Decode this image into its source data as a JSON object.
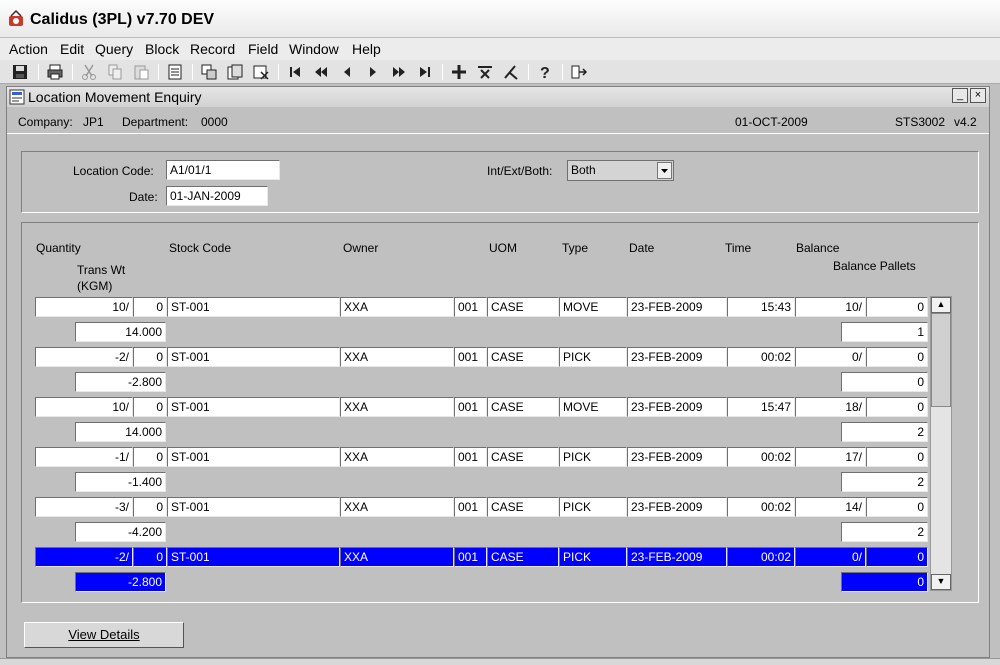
{
  "app": {
    "title": "Calidus (3PL) v7.70 DEV"
  },
  "menu": [
    "Action",
    "Edit",
    "Query",
    "Block",
    "Record",
    "Field",
    "Window",
    "Help"
  ],
  "toolbar": {
    "icons": [
      "save-icon",
      "print-icon",
      "cut-icon",
      "copy-icon",
      "paste-icon",
      "list-icon",
      "duplicate-record-icon",
      "copy-record-icon",
      "clear-record-icon",
      "first-record-icon",
      "previous-set-icon",
      "previous-record-icon",
      "next-record-icon",
      "next-set-icon",
      "last-record-icon",
      "insert-record-icon",
      "delete-record-icon",
      "clear-form-icon",
      "help-icon",
      "exit-icon"
    ]
  },
  "window": {
    "title": "Location Movement Enquiry",
    "minimize": "_",
    "close": "×"
  },
  "header": {
    "company_label": "Company:",
    "company": "JP1",
    "department_label": "Department:",
    "department": "0000",
    "date": "01-OCT-2009",
    "screen_code": "STS3002",
    "version": "v4.2"
  },
  "criteria": {
    "location_code_label": "Location Code:",
    "location_code": "A1/01/1",
    "date_label": "Date:",
    "date": "01-JAN-2009",
    "int_ext_label": "Int/Ext/Both:",
    "int_ext_value": "Both"
  },
  "columns": {
    "quantity": "Quantity",
    "stock_code": "Stock Code",
    "owner": "Owner",
    "uom": "UOM",
    "type": "Type",
    "date": "Date",
    "time": "Time",
    "balance": "Balance",
    "trans_wt": "Trans Wt",
    "trans_wt_unit": "(KGM)",
    "balance_pallets": "Balance Pallets"
  },
  "rows": [
    {
      "qty": "10/",
      "qty2": "0",
      "stock": "ST-001",
      "owner": "XXA",
      "pack": "001",
      "uom": "CASE",
      "type": "MOVE",
      "date": "23-FEB-2009",
      "time": "15:43",
      "bal": "10/",
      "bal2": "0",
      "wt": "14.000",
      "pallets": "1"
    },
    {
      "qty": "-2/",
      "qty2": "0",
      "stock": "ST-001",
      "owner": "XXA",
      "pack": "001",
      "uom": "CASE",
      "type": "PICK",
      "date": "23-FEB-2009",
      "time": "00:02",
      "bal": "0/",
      "bal2": "0",
      "wt": "-2.800",
      "pallets": "0"
    },
    {
      "qty": "10/",
      "qty2": "0",
      "stock": "ST-001",
      "owner": "XXA",
      "pack": "001",
      "uom": "CASE",
      "type": "MOVE",
      "date": "23-FEB-2009",
      "time": "15:47",
      "bal": "18/",
      "bal2": "0",
      "wt": "14.000",
      "pallets": "2"
    },
    {
      "qty": "-1/",
      "qty2": "0",
      "stock": "ST-001",
      "owner": "XXA",
      "pack": "001",
      "uom": "CASE",
      "type": "PICK",
      "date": "23-FEB-2009",
      "time": "00:02",
      "bal": "17/",
      "bal2": "0",
      "wt": "-1.400",
      "pallets": "2"
    },
    {
      "qty": "-3/",
      "qty2": "0",
      "stock": "ST-001",
      "owner": "XXA",
      "pack": "001",
      "uom": "CASE",
      "type": "PICK",
      "date": "23-FEB-2009",
      "time": "00:02",
      "bal": "14/",
      "bal2": "0",
      "wt": "-4.200",
      "pallets": "2"
    },
    {
      "qty": "-2/",
      "qty2": "0",
      "stock": "ST-001",
      "owner": "XXA",
      "pack": "001",
      "uom": "CASE",
      "type": "PICK",
      "date": "23-FEB-2009",
      "time": "00:02",
      "bal": "0/",
      "bal2": "0",
      "wt": "-2.800",
      "pallets": "0"
    }
  ],
  "selected_row_color": "#0000ff",
  "buttons": {
    "view_details": "View Details"
  }
}
